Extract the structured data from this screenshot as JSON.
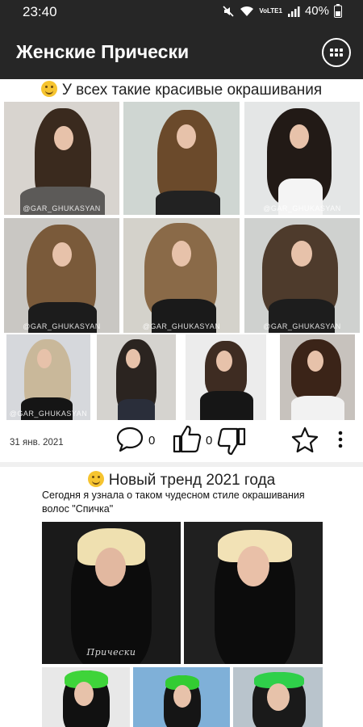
{
  "status_bar": {
    "time": "23:40",
    "network": "VoLTE1",
    "battery": "40%"
  },
  "app_bar": {
    "title": "Женские Прически",
    "menu_icon": "grid-menu-icon"
  },
  "posts": [
    {
      "emoji": "smiling-face-icon",
      "title": "У всех такие красивые окрашивания",
      "watermarks": [
        "@GAR_GHUKASYAN",
        "@GAR_GHUKASYAN",
        "@GAR_GHUKASYAN",
        "@GAR_GHUKASYAN",
        "@GAR_GHUKASYAN",
        "@GAR_GHUKASYAN"
      ],
      "date": "31 янв. 2021",
      "comments_count": "0",
      "likes_count": "0"
    },
    {
      "emoji": "grinning-face-icon",
      "title": "Новый тренд 2021 года",
      "text": "Сегодня я узнала о таком чудесном стиле окрашивания волос \"Спичка\"",
      "watermark": "Прически"
    }
  ],
  "colors": {
    "app_bar": "#262626",
    "background": "#ffffff",
    "divider": "#f0f0f0"
  }
}
